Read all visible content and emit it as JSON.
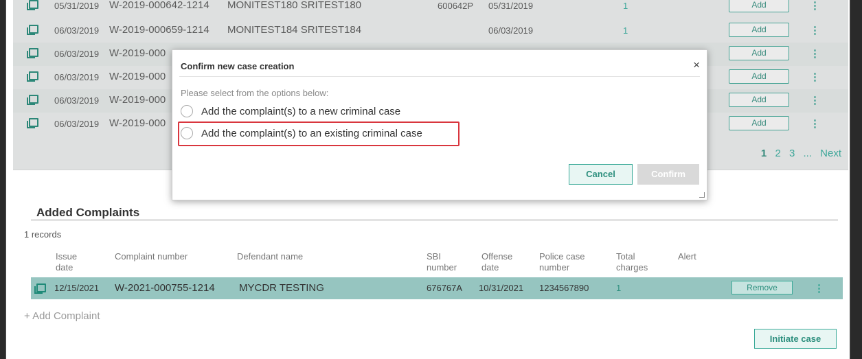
{
  "results": {
    "rows": [
      {
        "date": "05/31/2019",
        "number": "W-2019-000642-1214",
        "name": "MONITEST180 SRITEST180",
        "sbi": "600642P",
        "offense": "05/31/2019",
        "charges": "1",
        "action": "Add"
      },
      {
        "date": "06/03/2019",
        "number": "W-2019-000659-1214",
        "name": "MONITEST184 SRITEST184",
        "sbi": "",
        "offense": "06/03/2019",
        "charges": "1",
        "action": "Add"
      },
      {
        "date": "06/03/2019",
        "number": "W-2019-000",
        "name": "",
        "sbi": "",
        "offense": "",
        "charges": "",
        "action": "Add"
      },
      {
        "date": "06/03/2019",
        "number": "W-2019-000",
        "name": "",
        "sbi": "",
        "offense": "",
        "charges": "",
        "action": "Add"
      },
      {
        "date": "06/03/2019",
        "number": "W-2019-000",
        "name": "",
        "sbi": "",
        "offense": "",
        "charges": "",
        "action": "Add"
      },
      {
        "date": "06/03/2019",
        "number": "W-2019-000",
        "name": "",
        "sbi": "",
        "offense": "",
        "charges": "",
        "action": "Add"
      }
    ],
    "kebab": "⋮",
    "pager": {
      "p1": "1",
      "p2": "2",
      "p3": "3",
      "ellipsis": "...",
      "next": "Next"
    }
  },
  "modal": {
    "title": "Confirm new case creation",
    "close": "×",
    "prompt": "Please select from the options below:",
    "option_new": "Add the complaint(s) to a new criminal case",
    "option_existing": "Add the complaint(s) to an existing criminal case",
    "cancel": "Cancel",
    "confirm": "Confirm"
  },
  "added": {
    "title": "Added Complaints",
    "records": "1 records",
    "headers": {
      "issue": "Issue\ndate",
      "complaint": "Complaint number",
      "defendant": "Defendant name",
      "sbi": "SBI\nnumber",
      "offense": "Offense\ndate",
      "police": "Police case\nnumber",
      "charges": "Total\ncharges",
      "alert": "Alert"
    },
    "row": {
      "date": "12/15/2021",
      "number": "W-2021-000755-1214",
      "name": "MYCDR TESTING",
      "sbi": "676767A",
      "offense": "10/31/2021",
      "police": "1234567890",
      "charges": "1",
      "action": "Remove",
      "kebab": "⋮"
    },
    "add_link": "+ Add Complaint",
    "initiate": "Initiate case"
  }
}
